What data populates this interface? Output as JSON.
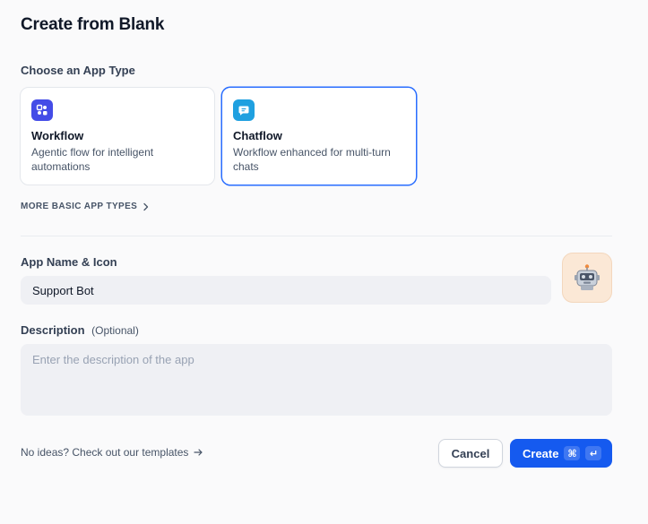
{
  "page": {
    "title": "Create from Blank"
  },
  "app_type": {
    "label": "Choose an App Type",
    "cards": [
      {
        "title": "Workflow",
        "description": "Agentic flow for intelligent automations",
        "icon": "workflow-icon",
        "icon_color": "#444ce7",
        "selected": false
      },
      {
        "title": "Chatflow",
        "description": "Workflow enhanced for multi-turn chats",
        "icon": "chatflow-icon",
        "icon_color": "#1fa0e0",
        "selected": true
      }
    ],
    "more_types": "MORE BASIC APP TYPES"
  },
  "app_name": {
    "label": "App Name & Icon",
    "value": "Support Bot",
    "avatar_icon": "robot-icon",
    "avatar_bg": "#fbe8d6"
  },
  "description": {
    "label": "Description",
    "optional": "(Optional)",
    "placeholder": "Enter the description of the app",
    "value": ""
  },
  "footer": {
    "templates_text": "No ideas? Check out our templates",
    "cancel_label": "Cancel",
    "create_label": "Create",
    "shortcut_keys": [
      "⌘",
      "↵"
    ]
  },
  "colors": {
    "accent": "#155aef",
    "selected_border": "#296dff"
  }
}
